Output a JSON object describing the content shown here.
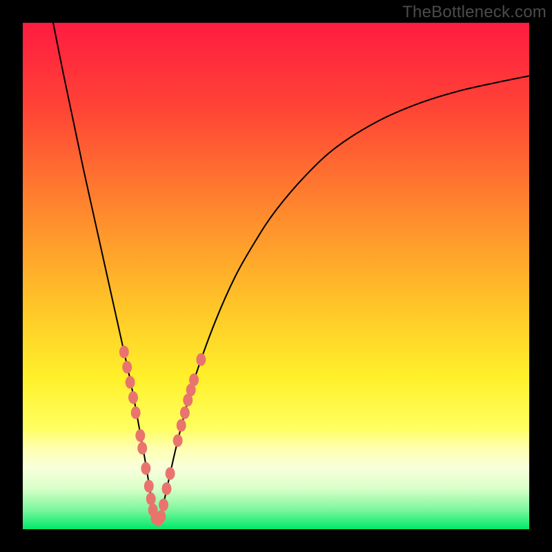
{
  "watermark": "TheBottleneck.com",
  "colors": {
    "frame": "#000000",
    "curve": "#000000",
    "marker": "#E9746E",
    "gradient_stops": [
      {
        "pct": 0,
        "color": "#FF1C41"
      },
      {
        "pct": 17,
        "color": "#FF4436"
      },
      {
        "pct": 35,
        "color": "#FF812E"
      },
      {
        "pct": 55,
        "color": "#FFC228"
      },
      {
        "pct": 70,
        "color": "#FFF02A"
      },
      {
        "pct": 80,
        "color": "#FFFF60"
      },
      {
        "pct": 84,
        "color": "#FFFFB0"
      },
      {
        "pct": 88,
        "color": "#F8FFDC"
      },
      {
        "pct": 92,
        "color": "#D8FFC8"
      },
      {
        "pct": 96,
        "color": "#80F7A0"
      },
      {
        "pct": 100,
        "color": "#00E969"
      }
    ]
  },
  "chart_data": {
    "type": "line",
    "title": "",
    "xlabel": "",
    "ylabel": "",
    "xlim": [
      0,
      100
    ],
    "ylim": [
      0,
      100
    ],
    "series": [
      {
        "name": "left-branch",
        "x": [
          6,
          8,
          10,
          12,
          14,
          16,
          18,
          19,
          20,
          21,
          22,
          23,
          24,
          25,
          26
        ],
        "y": [
          100,
          90,
          80.5,
          71,
          62,
          53,
          44,
          39.5,
          35,
          30.5,
          25.5,
          20,
          14.5,
          8.5,
          2
        ]
      },
      {
        "name": "right-branch",
        "x": [
          27,
          28,
          30,
          32,
          34,
          38,
          42,
          46,
          50,
          56,
          62,
          70,
          78,
          86,
          94,
          100
        ],
        "y": [
          2,
          6,
          15,
          23,
          30,
          41,
          50,
          57,
          63,
          70,
          75.5,
          80.5,
          84,
          86.5,
          88.3,
          89.5
        ]
      }
    ],
    "markers": {
      "name": "highlighted-points",
      "points": [
        {
          "x": 20.0,
          "y": 35.0
        },
        {
          "x": 20.6,
          "y": 32.0
        },
        {
          "x": 21.2,
          "y": 29.0
        },
        {
          "x": 21.8,
          "y": 26.0
        },
        {
          "x": 22.3,
          "y": 23.0
        },
        {
          "x": 23.2,
          "y": 18.5
        },
        {
          "x": 23.6,
          "y": 16.0
        },
        {
          "x": 24.3,
          "y": 12.0
        },
        {
          "x": 24.9,
          "y": 8.5
        },
        {
          "x": 25.3,
          "y": 6.0
        },
        {
          "x": 25.7,
          "y": 3.8
        },
        {
          "x": 26.2,
          "y": 2.2
        },
        {
          "x": 26.8,
          "y": 1.8
        },
        {
          "x": 27.3,
          "y": 2.5
        },
        {
          "x": 27.8,
          "y": 4.8
        },
        {
          "x": 28.4,
          "y": 8.0
        },
        {
          "x": 29.1,
          "y": 11.0
        },
        {
          "x": 30.6,
          "y": 17.5
        },
        {
          "x": 31.3,
          "y": 20.5
        },
        {
          "x": 32.0,
          "y": 23.0
        },
        {
          "x": 32.6,
          "y": 25.5
        },
        {
          "x": 33.2,
          "y": 27.5
        },
        {
          "x": 33.8,
          "y": 29.5
        },
        {
          "x": 35.2,
          "y": 33.5
        }
      ]
    }
  }
}
